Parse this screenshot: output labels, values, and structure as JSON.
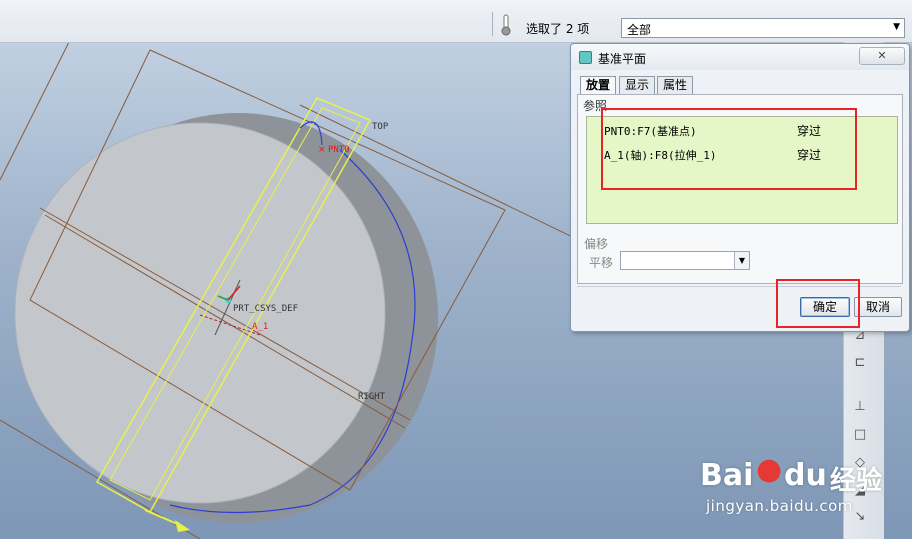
{
  "toolbar": {
    "selection_count": "选取了 2 项",
    "filter_value": "全部"
  },
  "model": {
    "label_top": "TOP",
    "label_pnt0": "PNT0",
    "label_csys": "PRT_CSYS_DEF",
    "label_axis": "A_1",
    "label_right": "RIGHT",
    "colors": {
      "body": "#c3c7cc",
      "plane": "#e8f04a",
      "edge": "#8a5a3a",
      "axis": "#b22222"
    }
  },
  "dialog": {
    "title": "基准平面",
    "close_label": "✕",
    "tabs": [
      {
        "label": "放置",
        "active": true
      },
      {
        "label": "显示",
        "active": false
      },
      {
        "label": "属性",
        "active": false
      }
    ],
    "references_label": "参照",
    "references": [
      {
        "name": "PNT0:F7(基准点)",
        "constraint": "穿过"
      },
      {
        "name": "A_1(轴):F8(拉伸_1)",
        "constraint": "穿过"
      }
    ],
    "offset_label": "偏移",
    "translate_label": "平移",
    "translate_value": "",
    "ok_label": "确定",
    "cancel_label": "取消"
  },
  "watermark": {
    "brand": "Bai",
    "brand_suffix": "du",
    "cn": "经验",
    "url": "jingyan.baidu.com"
  }
}
